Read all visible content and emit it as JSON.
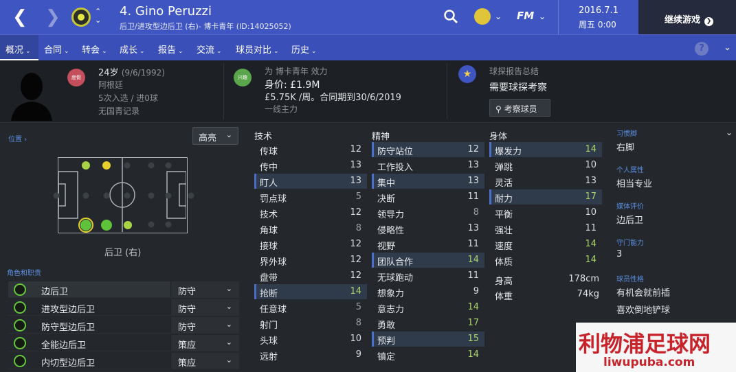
{
  "header": {
    "player_name": "4. Gino Peruzzi",
    "subtitle": "后卫/进攻型边后卫 (右)- 博卡青年 (ID:14025052)",
    "date": "2016.7.1",
    "time": "周五 0:00",
    "fm_label": "FM",
    "continue_label": "继续游戏"
  },
  "menu": [
    {
      "label": "概况"
    },
    {
      "label": "合同"
    },
    {
      "label": "转会"
    },
    {
      "label": "成长"
    },
    {
      "label": "报告"
    },
    {
      "label": "交流"
    },
    {
      "label": "球员对比"
    },
    {
      "label": "历史"
    }
  ],
  "info": {
    "status_badge": "度假",
    "age": "24岁",
    "dob": "(9/6/1992)",
    "nation": "阿根廷",
    "caps": "5次入选 / 进0球",
    "youth": "无国青记录",
    "club_badge": "兴趣",
    "club_line": "为 博卡青年 效力",
    "value": "身价: £1.9M",
    "wage": "£5.75K /周。合同期到30/6/2019",
    "squad_status": "一线主力",
    "report_title": "球探报告总结",
    "report_text": "需要球探考察",
    "scout_button": "考察球员"
  },
  "position": {
    "link": "位置",
    "highlight_label": "高亮",
    "pos_name": "后卫 (右)",
    "roles_title": "角色和职责"
  },
  "roles": [
    {
      "name": "边后卫",
      "duty": "防守"
    },
    {
      "name": "进攻型边后卫",
      "duty": "防守"
    },
    {
      "name": "防守型边后卫",
      "duty": "防守"
    },
    {
      "name": "全能边后卫",
      "duty": "策应"
    },
    {
      "name": "内切型边后卫",
      "duty": "策应"
    }
  ],
  "attr_headers": {
    "technical": "技术",
    "mental": "精神",
    "physical": "身体"
  },
  "technical": [
    [
      "传球",
      "12"
    ],
    [
      "传中",
      "13"
    ],
    [
      "盯人",
      "13"
    ],
    [
      "罚点球",
      "5"
    ],
    [
      "技术",
      "12"
    ],
    [
      "角球",
      "8"
    ],
    [
      "接球",
      "12"
    ],
    [
      "界外球",
      "12"
    ],
    [
      "盘带",
      "12"
    ],
    [
      "抢断",
      "14"
    ],
    [
      "任意球",
      "5"
    ],
    [
      "射门",
      "8"
    ],
    [
      "头球",
      "10"
    ],
    [
      "远射",
      "9"
    ]
  ],
  "mental": [
    [
      "防守站位",
      "12"
    ],
    [
      "工作投入",
      "13"
    ],
    [
      "集中",
      "13"
    ],
    [
      "决断",
      "11"
    ],
    [
      "领导力",
      "8"
    ],
    [
      "侵略性",
      "13"
    ],
    [
      "视野",
      "11"
    ],
    [
      "团队合作",
      "14"
    ],
    [
      "无球跑动",
      "11"
    ],
    [
      "想象力",
      "9"
    ],
    [
      "意志力",
      "14"
    ],
    [
      "勇敢",
      "17"
    ],
    [
      "预判",
      "15"
    ],
    [
      "镇定",
      "14"
    ]
  ],
  "physical": [
    [
      "爆发力",
      "14"
    ],
    [
      "弹跳",
      "10"
    ],
    [
      "灵活",
      "13"
    ],
    [
      "耐力",
      "17"
    ],
    [
      "平衡",
      "10"
    ],
    [
      "强壮",
      "11"
    ],
    [
      "速度",
      "14"
    ],
    [
      "体质",
      "14"
    ]
  ],
  "body": {
    "height_label": "身高",
    "height": "178cm",
    "weight_label": "体重",
    "weight": "74kg"
  },
  "sidebar": [
    {
      "label": "习惯脚",
      "value": "右脚"
    },
    {
      "label": "个人属性",
      "value": "相当专业"
    },
    {
      "label": "媒体评价",
      "value": "边后卫"
    },
    {
      "label": "守门能力",
      "value": "3"
    },
    {
      "label": "球员性格",
      "value": "有机会就前插"
    }
  ],
  "sidebar_extra": "喜欢倒地铲球",
  "watermark": {
    "title": "利物浦足球网",
    "url": "liwupuba.com"
  },
  "colors": {
    "value_low": "#9aa0a5",
    "value_mid": "#d9dcdf",
    "value_good": "#a8d46a",
    "accent": "#3f55c2"
  }
}
